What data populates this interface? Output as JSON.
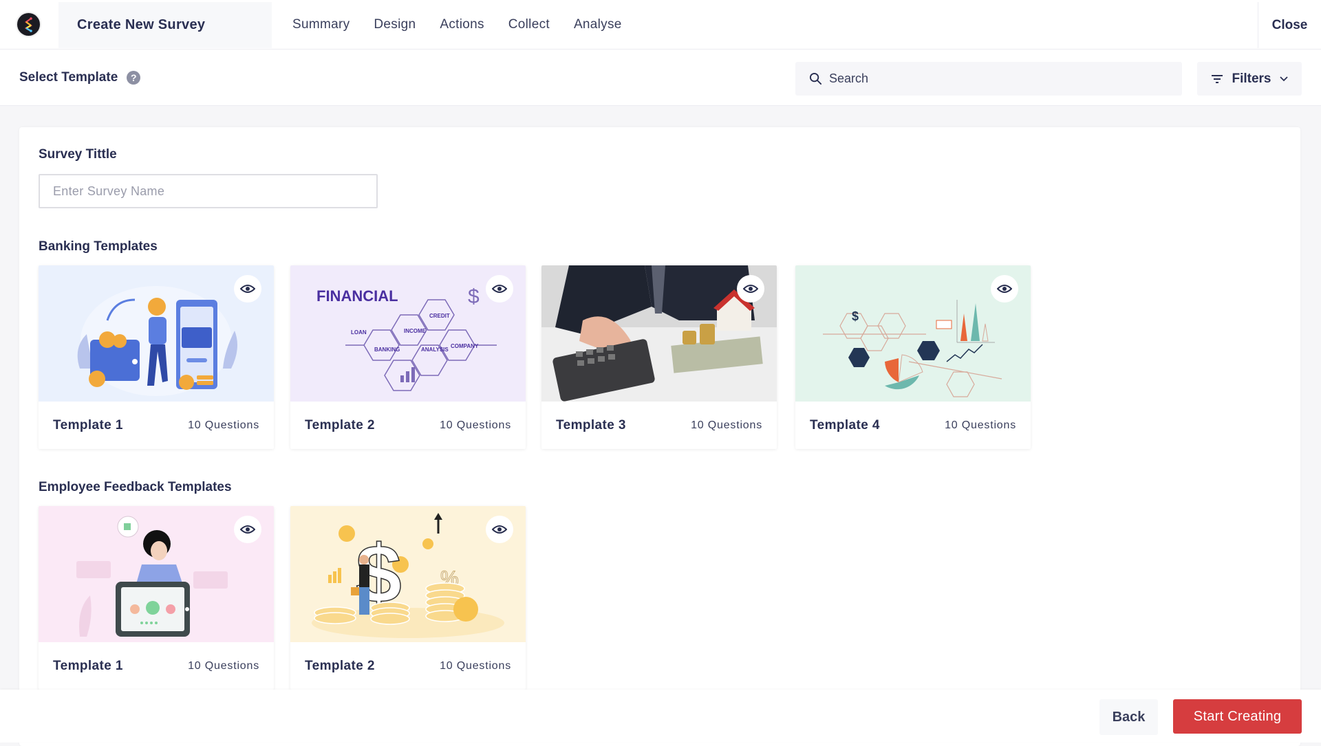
{
  "header": {
    "app_title": "Create New Survey",
    "tabs": [
      {
        "label": "Summary"
      },
      {
        "label": "Design"
      },
      {
        "label": "Actions"
      },
      {
        "label": "Collect"
      },
      {
        "label": "Analyse"
      }
    ],
    "close_label": "Close"
  },
  "subheader": {
    "title": "Select Template",
    "help_icon": "question-circle-icon",
    "search_placeholder": "Search",
    "filters_label": "Filters"
  },
  "form": {
    "survey_title_label": "Survey Tittle",
    "survey_title_placeholder": "Enter Survey Name",
    "survey_title_value": ""
  },
  "sections": [
    {
      "title": "Banking Templates",
      "templates": [
        {
          "name": "Template 1",
          "questions": "10 Questions",
          "illustration": "wallet-phone-coins",
          "bg": "#eaf1fd"
        },
        {
          "name": "Template 2",
          "questions": "10 Questions",
          "illustration": "financial-hexagons",
          "bg": "#f1ebfb"
        },
        {
          "name": "Template 3",
          "questions": "10 Questions",
          "illustration": "calculator-house-photo",
          "bg": "#dcdcdc"
        },
        {
          "name": "Template 4",
          "questions": "10 Questions",
          "illustration": "finance-network-icons",
          "bg": "#e3f4ec"
        }
      ]
    },
    {
      "title": "Employee Feedback Templates",
      "templates": [
        {
          "name": "Template 1",
          "questions": "10 Questions",
          "illustration": "feedback-tablet-smileys",
          "bg": "#fbe9f6"
        },
        {
          "name": "Template 2",
          "questions": "10 Questions",
          "illustration": "dollar-coins-growth",
          "bg": "#fdf3da"
        }
      ]
    }
  ],
  "footer": {
    "back_label": "Back",
    "start_label": "Start Creating",
    "accent_color": "#d63d3f"
  }
}
